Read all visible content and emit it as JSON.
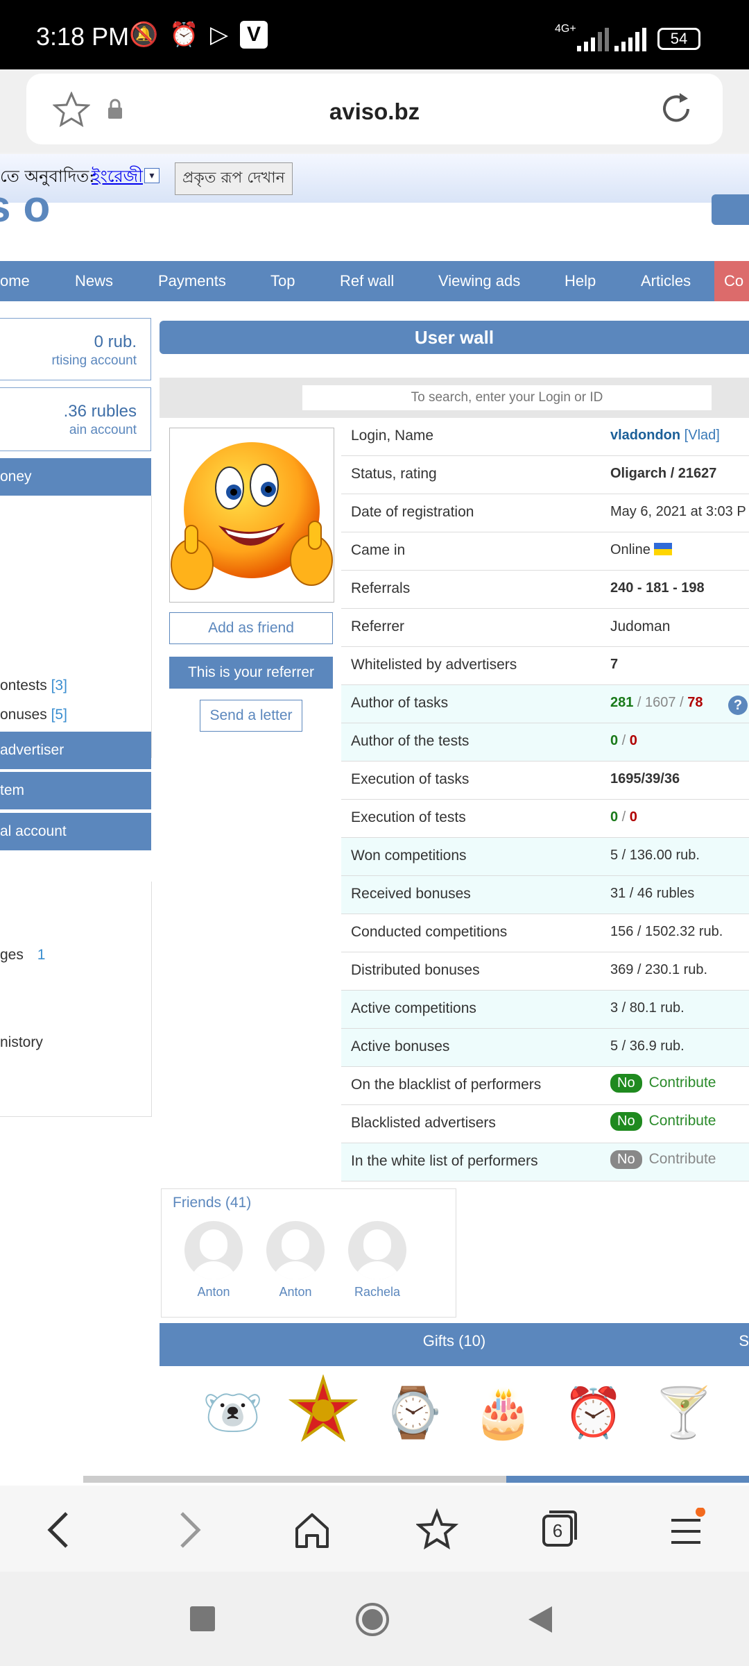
{
  "status_bar": {
    "time": "3:18 PM",
    "network": "4G+",
    "battery": "54"
  },
  "browser": {
    "url": "aviso.bz"
  },
  "translate_bar": {
    "label": "তে অনুবাদিত:",
    "language": "ইংরেজী",
    "show_original": "প্রকৃত রূপ দেখান"
  },
  "site": {
    "logo_fragment": "s o"
  },
  "nav": {
    "items": [
      "ome",
      "News",
      "Payments",
      "Top",
      "Ref wall",
      "Viewing ads",
      "Help",
      "Articles",
      "Co"
    ]
  },
  "sidebar": {
    "ad_account": {
      "amount": "0 rub.",
      "label": "rtising account"
    },
    "main_account": {
      "amount": ".36 rubles",
      "label": "ain account"
    },
    "money": "oney",
    "contests": {
      "label": "ontests",
      "count": "[3]"
    },
    "bonuses": {
      "label": "onuses",
      "count": "[5]"
    },
    "advertiser": "advertiser",
    "system": "tem",
    "personal_account": "al account",
    "messages": {
      "label": "ges",
      "count": "1"
    },
    "history": "nistory"
  },
  "wall": {
    "title": "User wall",
    "search_placeholder": "To search, enter your Login or ID",
    "buttons": {
      "add_friend": "Add as friend",
      "your_referrer": "This is your referrer",
      "send_letter": "Send a letter"
    }
  },
  "info": {
    "login_label": "Login, Name",
    "login": "vladondon",
    "name": "[Vlad]",
    "status_label": "Status, rating",
    "status": "Oligarch / 21627",
    "reg_label": "Date of registration",
    "reg": "May 6, 2021 at 3:03 P",
    "came_label": "Came in",
    "came": "Online",
    "referrals_label": "Referrals",
    "referrals": "240 - 181 - 198",
    "referrer_label": "Referrer",
    "referrer": "Judoman",
    "whitelisted_label": "Whitelisted by advertisers",
    "whitelisted": "7",
    "author_tasks_label": "Author of tasks",
    "author_tasks": {
      "a": "281",
      "sep1": " / ",
      "b": "1607",
      "sep2": " / ",
      "c": "78"
    },
    "author_tests_label": "Author of the tests",
    "author_tests": {
      "a": "0",
      "sep": " / ",
      "b": "0"
    },
    "exec_tasks_label": "Execution of tasks",
    "exec_tasks": "1695/39/36",
    "exec_tests_label": "Execution of tests",
    "exec_tests": {
      "a": "0",
      "sep": " / ",
      "b": "0"
    },
    "won_label": "Won competitions",
    "won": "5 / 136.00 rub.",
    "recv_label": "Received bonuses",
    "recv": "31 / 46 rubles",
    "cond_label": "Conducted competitions",
    "cond": "156 / 1502.32 rub.",
    "dist_label": "Distributed bonuses",
    "dist": "369 / 230.1 rub.",
    "active_comp_label": "Active competitions",
    "active_comp": "3 / 80.1 rub.",
    "active_bon_label": "Active bonuses",
    "active_bon": "5 / 36.9 rub.",
    "bl_perf_label": "On the blacklist of performers",
    "bl_perf": {
      "pill": "No",
      "action": "Contribute"
    },
    "bl_adv_label": "Blacklisted advertisers",
    "bl_adv": {
      "pill": "No",
      "action": "Contribute"
    },
    "wl_perf_label": "In the white list of performers",
    "wl_perf": {
      "pill": "No",
      "action": "Contribute"
    },
    "help": "?"
  },
  "friends": {
    "title": "Friends (41)",
    "list": [
      "Anton",
      "Anton",
      "Rachela"
    ]
  },
  "gifts": {
    "title": "Gifts (10)",
    "edge": "S",
    "items": [
      "polar-bear",
      "order-star",
      "wristwatch",
      "cat-cake",
      "crying-clock",
      "cocktail"
    ]
  },
  "bottom_bar": {
    "tabs_count": "6"
  },
  "colors": {
    "accent": "#5b87bd",
    "green": "#2a8a2a",
    "red": "#b00000"
  }
}
